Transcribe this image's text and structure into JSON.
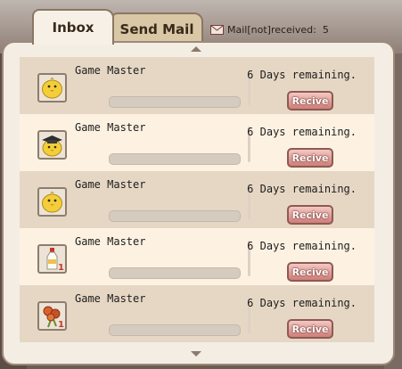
{
  "tabs": [
    {
      "label": "Inbox",
      "active": true
    },
    {
      "label": "Send Mail",
      "active": false
    }
  ],
  "mail_status": {
    "label": "Mail[not]received:",
    "count": "5",
    "icon": "envelope-icon"
  },
  "mails": [
    {
      "sender": "Game Master",
      "remaining": "6 Days remaining.",
      "button": "Recive",
      "icon": "yellow-chick-icon",
      "qty": ""
    },
    {
      "sender": "Game Master",
      "remaining": "6 Days remaining.",
      "button": "Recive",
      "icon": "chick-graduate-hat-icon",
      "qty": ""
    },
    {
      "sender": "Game Master",
      "remaining": "6 Days remaining.",
      "button": "Recive",
      "icon": "yellow-chick-icon",
      "qty": ""
    },
    {
      "sender": "Game Master",
      "remaining": "6 Days remaining.",
      "button": "Recive",
      "icon": "milk-bottle-icon",
      "qty": "1"
    },
    {
      "sender": "Game Master",
      "remaining": "6 Days remaining.",
      "button": "Recive",
      "icon": "flower-bundle-icon",
      "qty": "1"
    }
  ],
  "colors": {
    "accent_button": "#cf7e78",
    "row_odd": "#e6d7c4",
    "row_even": "#fdf2e2",
    "panel": "#f4ede3"
  }
}
